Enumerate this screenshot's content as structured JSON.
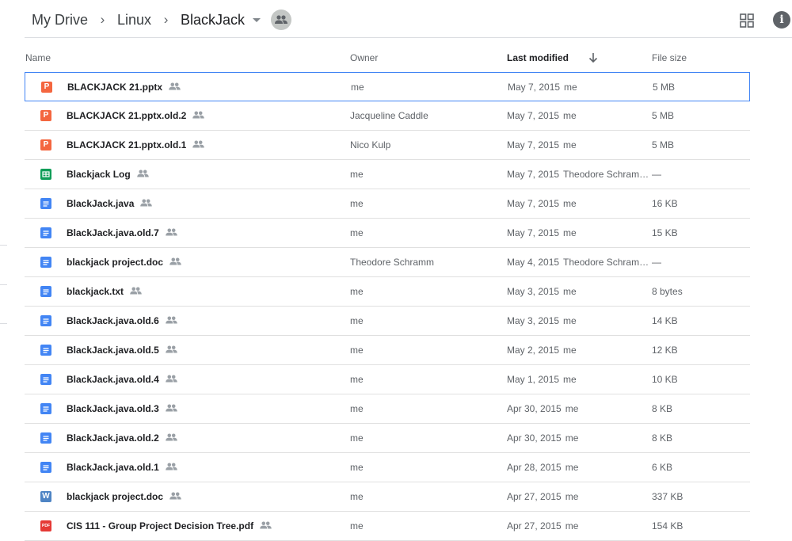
{
  "breadcrumb": {
    "items": [
      "My Drive",
      "Linux"
    ],
    "current": "BlackJack"
  },
  "icons": {
    "shared_folder": "shared-folder-icon",
    "grid_view": "grid-view-icon",
    "info": "info-icon",
    "sort": "arrow-down-icon"
  },
  "info_glyph": "i",
  "columns": {
    "name": "Name",
    "owner": "Owner",
    "last_modified": "Last modified",
    "file_size": "File size"
  },
  "colors": {
    "slides": "#f4663f",
    "sheets": "#0f9d58",
    "docs": "#4285f4",
    "word": "#4e84c4",
    "pdf": "#e53935",
    "selection": "#4285f4"
  },
  "files": [
    {
      "name": "BLACKJACK 21.pptx",
      "type": "slides",
      "type_glyph": "P",
      "owner": "me",
      "date": "May 7, 2015",
      "by": "me",
      "size": "5 MB",
      "selected": true
    },
    {
      "name": "BLACKJACK 21.pptx.old.2",
      "type": "slides",
      "type_glyph": "P",
      "owner": "Jacqueline Caddle",
      "date": "May 7, 2015",
      "by": "me",
      "size": "5 MB"
    },
    {
      "name": "BLACKJACK 21.pptx.old.1",
      "type": "slides",
      "type_glyph": "P",
      "owner": "Nico Kulp",
      "date": "May 7, 2015",
      "by": "me",
      "size": "5 MB"
    },
    {
      "name": "Blackjack Log",
      "type": "sheet",
      "type_glyph": "",
      "owner": "me",
      "date": "May 7, 2015",
      "by": "Theodore Schram…",
      "size": "—"
    },
    {
      "name": "BlackJack.java",
      "type": "doc",
      "type_glyph": "",
      "owner": "me",
      "date": "May 7, 2015",
      "by": "me",
      "size": "16 KB"
    },
    {
      "name": "BlackJack.java.old.7",
      "type": "doc",
      "type_glyph": "",
      "owner": "me",
      "date": "May 7, 2015",
      "by": "me",
      "size": "15 KB"
    },
    {
      "name": "blackjack project.doc",
      "type": "doc",
      "type_glyph": "",
      "owner": "Theodore Schramm",
      "date": "May 4, 2015",
      "by": "Theodore Schram…",
      "size": "—"
    },
    {
      "name": "blackjack.txt",
      "type": "doc",
      "type_glyph": "",
      "owner": "me",
      "date": "May 3, 2015",
      "by": "me",
      "size": "8 bytes"
    },
    {
      "name": "BlackJack.java.old.6",
      "type": "doc",
      "type_glyph": "",
      "owner": "me",
      "date": "May 3, 2015",
      "by": "me",
      "size": "14 KB"
    },
    {
      "name": "BlackJack.java.old.5",
      "type": "doc",
      "type_glyph": "",
      "owner": "me",
      "date": "May 2, 2015",
      "by": "me",
      "size": "12 KB"
    },
    {
      "name": "BlackJack.java.old.4",
      "type": "doc",
      "type_glyph": "",
      "owner": "me",
      "date": "May 1, 2015",
      "by": "me",
      "size": "10 KB"
    },
    {
      "name": "BlackJack.java.old.3",
      "type": "doc",
      "type_glyph": "",
      "owner": "me",
      "date": "Apr 30, 2015",
      "by": "me",
      "size": "8 KB"
    },
    {
      "name": "BlackJack.java.old.2",
      "type": "doc",
      "type_glyph": "",
      "owner": "me",
      "date": "Apr 30, 2015",
      "by": "me",
      "size": "8 KB"
    },
    {
      "name": "BlackJack.java.old.1",
      "type": "doc",
      "type_glyph": "",
      "owner": "me",
      "date": "Apr 28, 2015",
      "by": "me",
      "size": "6 KB"
    },
    {
      "name": "blackjack project.doc",
      "type": "word",
      "type_glyph": "W",
      "owner": "me",
      "date": "Apr 27, 2015",
      "by": "me",
      "size": "337 KB"
    },
    {
      "name": "CIS 111 - Group Project Decision Tree.pdf",
      "type": "pdf",
      "type_glyph": "PDF",
      "owner": "me",
      "date": "Apr 27, 2015",
      "by": "me",
      "size": "154 KB"
    }
  ]
}
